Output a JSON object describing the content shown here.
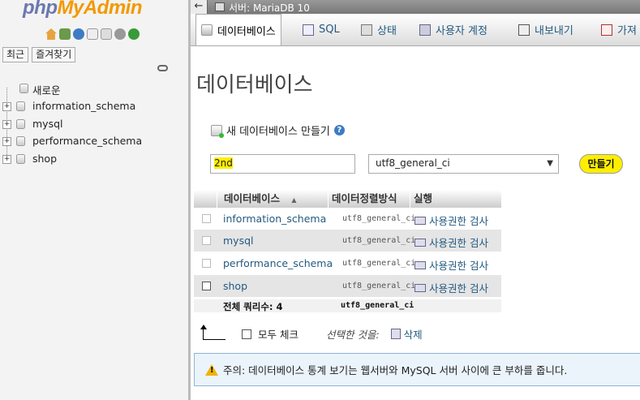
{
  "nav": {
    "logo_php": "php",
    "logo_myadmin": "MyAdmin",
    "recent_label": "최근",
    "favorites_label": "즐겨찾기",
    "tree": [
      {
        "label": "새로운",
        "type": "new"
      },
      {
        "label": "information_schema",
        "type": "db"
      },
      {
        "label": "mysql",
        "type": "db"
      },
      {
        "label": "performance_schema",
        "type": "db"
      },
      {
        "label": "shop",
        "type": "db"
      }
    ]
  },
  "topbar": {
    "back": "←",
    "server": "서버: MariaDB 10"
  },
  "tabs": [
    {
      "label": "데이터베이스",
      "active": true
    },
    {
      "label": "SQL",
      "active": false
    },
    {
      "label": "상태",
      "active": false
    },
    {
      "label": "사용자 계정",
      "active": false
    },
    {
      "label": "내보내기",
      "active": false
    },
    {
      "label": "가져",
      "active": false
    }
  ],
  "main": {
    "title": "데이터베이스",
    "create_title": "새 데이터베이스 만들기",
    "db_name_value": "2nd",
    "collation_value": "utf8_general_ci",
    "create_button": "만들기"
  },
  "table": {
    "headers": {
      "name": "데이터베이스",
      "sort": "▲",
      "collation": "데이터정렬방식",
      "action": "실행"
    },
    "rows": [
      {
        "name": "information_schema",
        "collation": "utf8_general_ci",
        "action": "사용권한 검사"
      },
      {
        "name": "mysql",
        "collation": "utf8_general_ci",
        "action": "사용권한 검사"
      },
      {
        "name": "performance_schema",
        "collation": "utf8_general_ci",
        "action": "사용권한 검사"
      },
      {
        "name": "shop",
        "collation": "utf8_general_ci",
        "action": "사용권한 검사"
      }
    ],
    "total_label": "전체 쿼리수: 4",
    "total_collation": "utf8_general_ci"
  },
  "bulk": {
    "check_all": "모두 체크",
    "with_selected": "선택한 것을:",
    "delete": "삭제"
  },
  "notice": "주의: 데이터베이스 통계 보기는 웹서버와 MySQL 서버 사이에 큰 부하를 줍니다."
}
